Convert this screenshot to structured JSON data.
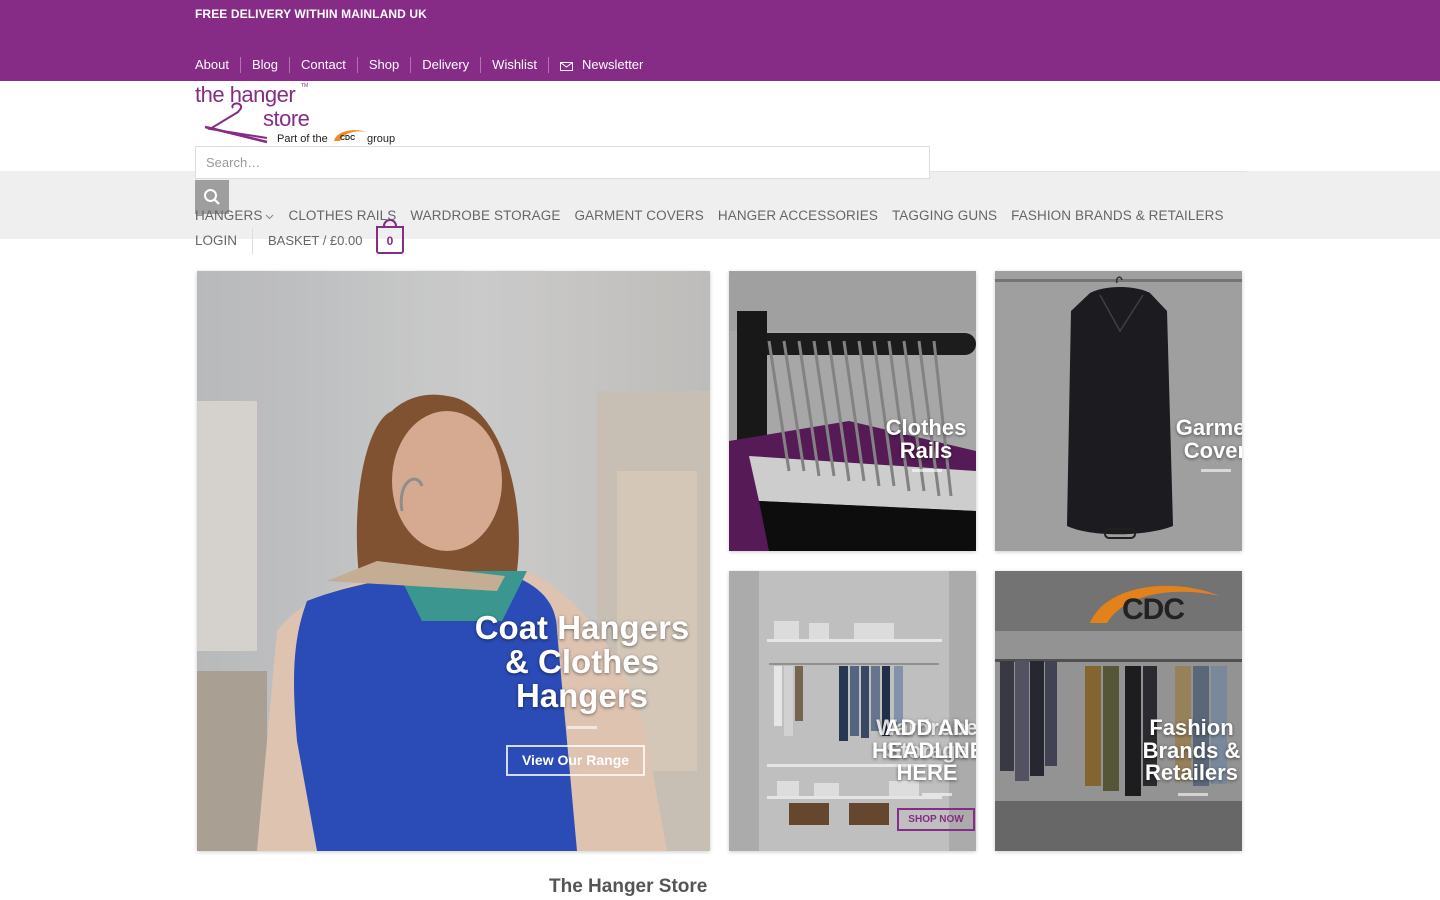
{
  "topbar": {
    "promo": "FREE DELIVERY WITHIN MAINLAND UK",
    "links": [
      "About",
      "Blog",
      "Contact",
      "Shop",
      "Delivery",
      "Wishlist"
    ],
    "newsletter": "Newsletter",
    "color": "#862b86"
  },
  "logo": {
    "line1": "the hanger",
    "tm": "TM",
    "line2": "store",
    "tagline_prefix": "Part of the",
    "badge": "CDC",
    "tagline_suffix": "group"
  },
  "search": {
    "placeholder": "Search…"
  },
  "mainnav": [
    "HANGERS",
    "CLOTHES RAILS",
    "WARDROBE STORAGE",
    "GARMENT COVERS",
    "HANGER ACCESSORIES",
    "TAGGING GUNS",
    "FASHION BRANDS & RETAILERS"
  ],
  "account": {
    "login": "LOGIN",
    "basket": "BASKET / £0.00",
    "cart_count": "0"
  },
  "tiles": {
    "hero": {
      "line1": "Coat Hangers",
      "line2": "& Clothes",
      "line3": "Hangers",
      "button": "View Our Range"
    },
    "rails": {
      "line1": "Clothes",
      "line2": "Rails"
    },
    "covers": {
      "line1": "Garment",
      "line2": "Covers"
    },
    "wardrobe": {
      "line1": "ADD AN",
      "line2": "HEADLINE",
      "line3": "HERE",
      "overlap1": "Wardrobe",
      "overlap2": "Storage",
      "button": "SHOP NOW"
    },
    "fashion": {
      "line1": "Fashion",
      "line2": "Brands &",
      "line3": "Retailers",
      "logo": "CDC"
    }
  },
  "footer": {
    "title": "The Hanger Store"
  }
}
